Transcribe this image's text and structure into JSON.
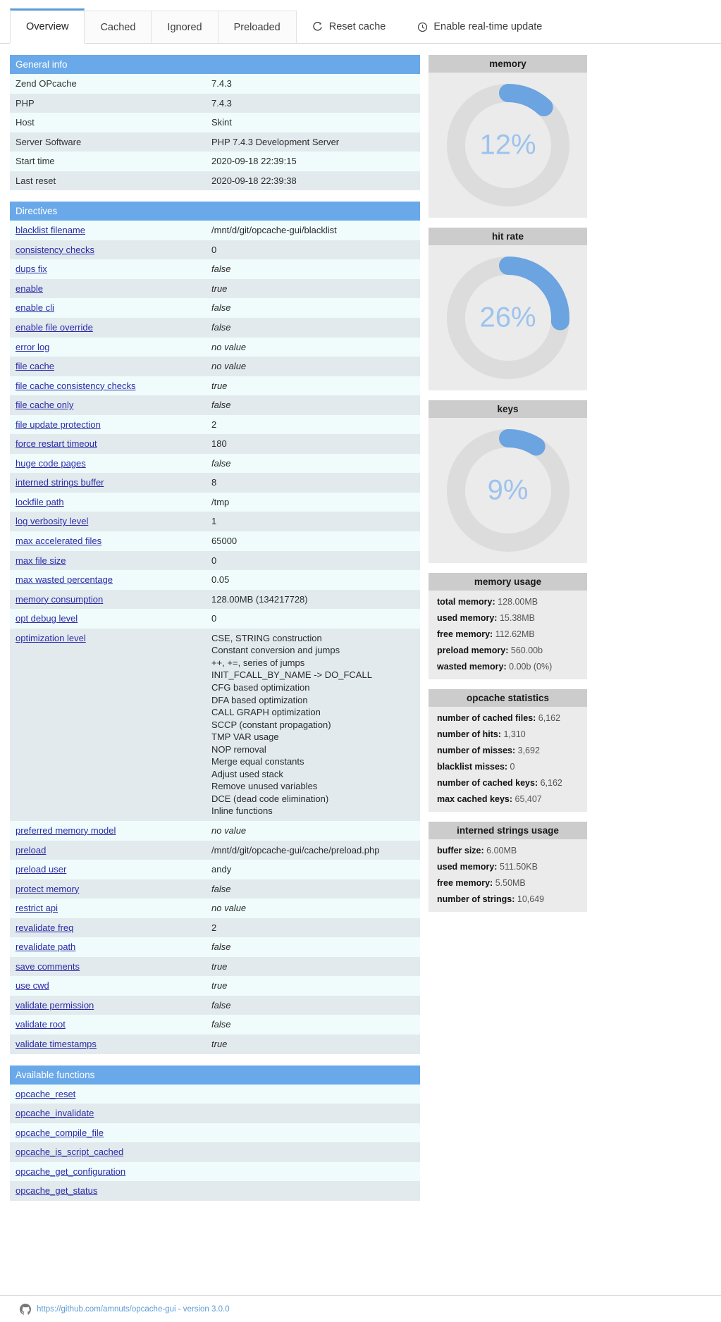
{
  "tabs": [
    {
      "label": "Overview",
      "icon": null,
      "active": true
    },
    {
      "label": "Cached",
      "icon": null,
      "active": false
    },
    {
      "label": "Ignored",
      "icon": null,
      "active": false
    },
    {
      "label": "Preloaded",
      "icon": null,
      "active": false
    },
    {
      "label": "Reset cache",
      "icon": "refresh-icon",
      "active": false
    },
    {
      "label": "Enable real-time update",
      "icon": "clock-icon",
      "active": false
    }
  ],
  "general_info": {
    "title": "General info",
    "rows": [
      {
        "key": "Zend OPcache",
        "value": "7.4.3"
      },
      {
        "key": "PHP",
        "value": "7.4.3"
      },
      {
        "key": "Host",
        "value": "Skint"
      },
      {
        "key": "Server Software",
        "value": "PHP 7.4.3 Development Server"
      },
      {
        "key": "Start time",
        "value": "2020-09-18 22:39:15"
      },
      {
        "key": "Last reset",
        "value": "2020-09-18 22:39:38"
      }
    ]
  },
  "directives": {
    "title": "Directives",
    "rows": [
      {
        "key": "blacklist filename",
        "value": "/mnt/d/git/opcache-gui/blacklist",
        "italic": false
      },
      {
        "key": "consistency checks",
        "value": "0",
        "italic": false
      },
      {
        "key": "dups fix",
        "value": "false",
        "italic": true
      },
      {
        "key": "enable",
        "value": "true",
        "italic": true
      },
      {
        "key": "enable cli",
        "value": "false",
        "italic": true
      },
      {
        "key": "enable file override",
        "value": "false",
        "italic": true
      },
      {
        "key": "error log",
        "value": "no value",
        "italic": true
      },
      {
        "key": "file cache",
        "value": "no value",
        "italic": true
      },
      {
        "key": "file cache consistency checks",
        "value": "true",
        "italic": true
      },
      {
        "key": "file cache only",
        "value": "false",
        "italic": true
      },
      {
        "key": "file update protection",
        "value": "2",
        "italic": false
      },
      {
        "key": "force restart timeout",
        "value": "180",
        "italic": false
      },
      {
        "key": "huge code pages",
        "value": "false",
        "italic": true
      },
      {
        "key": "interned strings buffer",
        "value": "8",
        "italic": false
      },
      {
        "key": "lockfile path",
        "value": "/tmp",
        "italic": false
      },
      {
        "key": "log verbosity level",
        "value": "1",
        "italic": false
      },
      {
        "key": "max accelerated files",
        "value": "65000",
        "italic": false
      },
      {
        "key": "max file size",
        "value": "0",
        "italic": false
      },
      {
        "key": "max wasted percentage",
        "value": "0.05",
        "italic": false
      },
      {
        "key": "memory consumption",
        "value": "128.00MB (134217728)",
        "italic": false
      },
      {
        "key": "opt debug level",
        "value": "0",
        "italic": false
      },
      {
        "key": "optimization level",
        "value": "CSE, STRING construction\nConstant conversion and jumps\n++, +=, series of jumps\nINIT_FCALL_BY_NAME -> DO_FCALL\nCFG based optimization\nDFA based optimization\nCALL GRAPH optimization\nSCCP (constant propagation)\nTMP VAR usage\nNOP removal\nMerge equal constants\nAdjust used stack\nRemove unused variables\nDCE (dead code elimination)\nInline functions",
        "italic": false
      },
      {
        "key": "preferred memory model",
        "value": "no value",
        "italic": true
      },
      {
        "key": "preload",
        "value": "/mnt/d/git/opcache-gui/cache/preload.php",
        "italic": false
      },
      {
        "key": "preload user",
        "value": "andy",
        "italic": false
      },
      {
        "key": "protect memory",
        "value": "false",
        "italic": true
      },
      {
        "key": "restrict api",
        "value": "no value",
        "italic": true
      },
      {
        "key": "revalidate freq",
        "value": "2",
        "italic": false
      },
      {
        "key": "revalidate path",
        "value": "false",
        "italic": true
      },
      {
        "key": "save comments",
        "value": "true",
        "italic": true
      },
      {
        "key": "use cwd",
        "value": "true",
        "italic": true
      },
      {
        "key": "validate permission",
        "value": "false",
        "italic": true
      },
      {
        "key": "validate root",
        "value": "false",
        "italic": true
      },
      {
        "key": "validate timestamps",
        "value": "true",
        "italic": true
      }
    ]
  },
  "available_functions": {
    "title": "Available functions",
    "rows": [
      "opcache_reset",
      "opcache_invalidate",
      "opcache_compile_file",
      "opcache_is_script_cached",
      "opcache_get_configuration",
      "opcache_get_status"
    ]
  },
  "gauges": [
    {
      "title": "memory",
      "percent": 12,
      "label": "12%"
    },
    {
      "title": "hit rate",
      "percent": 26,
      "label": "26%"
    },
    {
      "title": "keys",
      "percent": 9,
      "label": "9%"
    }
  ],
  "memory_usage": {
    "title": "memory usage",
    "rows": [
      {
        "label": "total memory:",
        "value": "128.00MB"
      },
      {
        "label": "used memory:",
        "value": "15.38MB"
      },
      {
        "label": "free memory:",
        "value": "112.62MB"
      },
      {
        "label": "preload memory:",
        "value": "560.00b"
      },
      {
        "label": "wasted memory:",
        "value": "0.00b (0%)"
      }
    ]
  },
  "opcache_statistics": {
    "title": "opcache statistics",
    "rows": [
      {
        "label": "number of cached files:",
        "value": "6,162"
      },
      {
        "label": "number of hits:",
        "value": "1,310"
      },
      {
        "label": "number of misses:",
        "value": "3,692"
      },
      {
        "label": "blacklist misses:",
        "value": "0"
      },
      {
        "label": "number of cached keys:",
        "value": "6,162"
      },
      {
        "label": "max cached keys:",
        "value": "65,407"
      }
    ]
  },
  "interned_strings_usage": {
    "title": "interned strings usage",
    "rows": [
      {
        "label": "buffer size:",
        "value": "6.00MB"
      },
      {
        "label": "used memory:",
        "value": "511.50KB"
      },
      {
        "label": "free memory:",
        "value": "5.50MB"
      },
      {
        "label": "number of strings:",
        "value": "10,649"
      }
    ]
  },
  "footer": {
    "link_text": "https://github.com/amnuts/opcache-gui - version 3.0.0",
    "icon": "github-icon"
  },
  "colors": {
    "section_header": "#6aa9e9",
    "gauge_fill": "#6ba4e0",
    "gauge_track": "#dcdcdc",
    "row_odd": "#effcfb",
    "row_even": "#e2eaed",
    "panel_header": "#cccccc",
    "link": "#2a2aa8",
    "footer_link": "#5c9ad6"
  }
}
